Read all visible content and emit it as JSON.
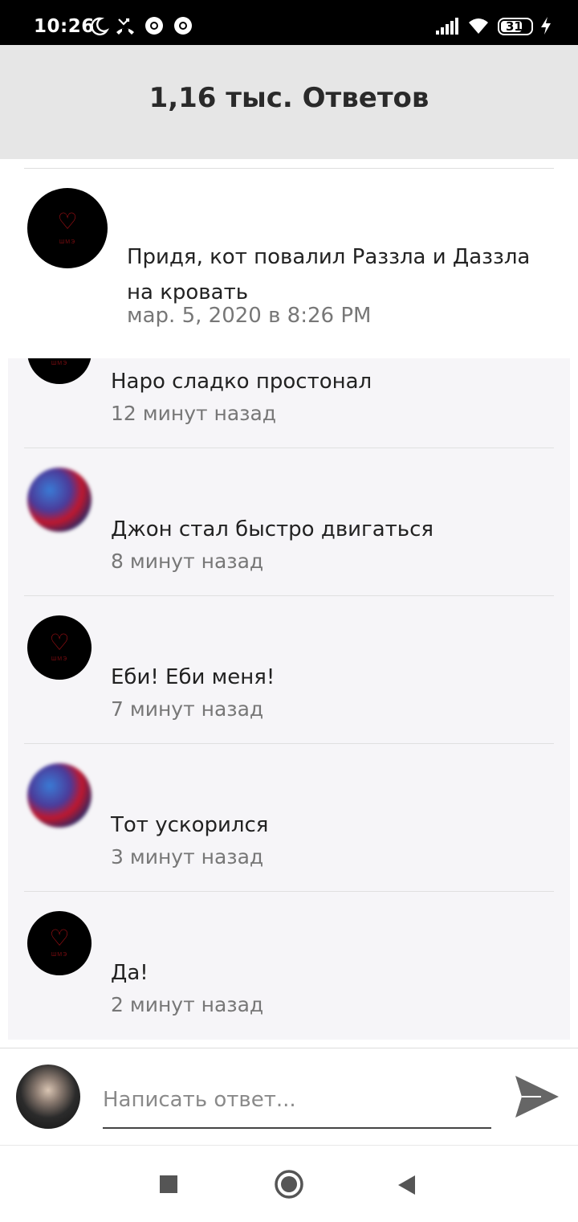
{
  "status_bar": {
    "time": "10:26",
    "battery": "31",
    "icons": [
      "moon-icon",
      "missed-call-icon",
      "chrome-icon",
      "chrome-icon",
      "signal-icon",
      "wifi-icon",
      "battery-icon",
      "charging-icon"
    ]
  },
  "header": {
    "title": "1,16 тыс. Ответов"
  },
  "main_comment": {
    "avatar_caption": "ШМЭ",
    "text": "Придя, кот повалил Раззла и Даззла на кровать",
    "time": "мар. 5, 2020 в 8:26 PM"
  },
  "replies": [
    {
      "avatar": "heart",
      "text": "Наро сладко простонал",
      "time": "12 минут назад"
    },
    {
      "avatar": "blur",
      "text": "Джон стал быстро двигаться",
      "time": "8 минут назад"
    },
    {
      "avatar": "heart",
      "text": "Еби! Еби меня!",
      "time": "7 минут назад"
    },
    {
      "avatar": "blur",
      "text": "Тот ускорился",
      "time": "3 минут назад"
    },
    {
      "avatar": "heart",
      "text": "Да!",
      "time": "2 минут назад"
    }
  ],
  "composer": {
    "placeholder": "Написать ответ...",
    "value": ""
  },
  "nav": {
    "icons": [
      "recents-square-icon",
      "home-circle-icon",
      "back-triangle-icon"
    ]
  },
  "colors": {
    "header_bg": "#e6e6e6",
    "replies_bg": "#f6f5f8",
    "secondary_text": "#777777"
  }
}
